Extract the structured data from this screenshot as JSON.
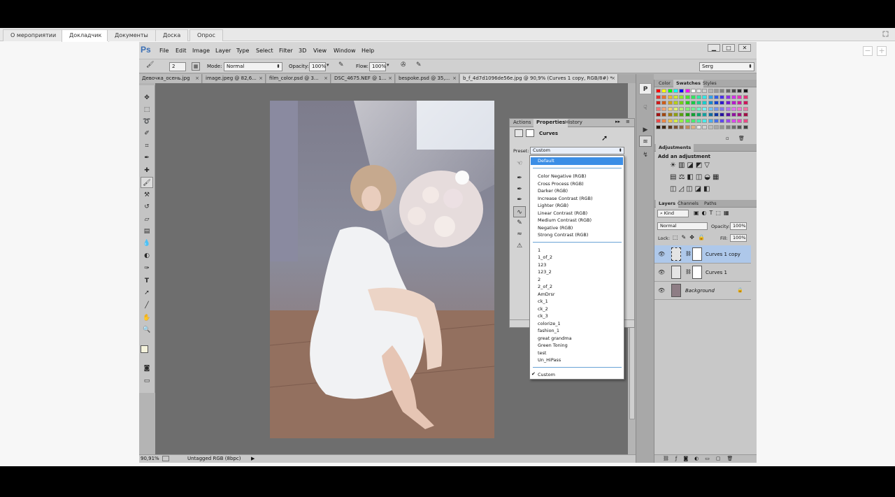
{
  "outer_tabs": [
    "О мероприятии",
    "Докладчик",
    "Документы",
    "Доска",
    "Опрос"
  ],
  "outer_active_tab": "Докладчик",
  "side_buttons": [
    "−",
    "+"
  ],
  "ps": {
    "logo": "Ps",
    "menu": [
      "File",
      "Edit",
      "Image",
      "Layer",
      "Type",
      "Select",
      "Filter",
      "3D",
      "View",
      "Window",
      "Help"
    ],
    "window_buttons": [
      "▁",
      "□",
      "✕"
    ],
    "options": {
      "brush_size": "2",
      "mode_label": "Mode:",
      "mode_value": "Normal",
      "opacity_label": "Opacity:",
      "opacity_value": "100%",
      "flow_label": "Flow:",
      "flow_value": "100%",
      "workspace": "Serg"
    },
    "doc_tabs": [
      {
        "label": "Девочка_осень.jpg",
        "active": false
      },
      {
        "label": "image.jpeg @ 82,6...",
        "active": false
      },
      {
        "label": "film_color.psd @ 3...",
        "active": false
      },
      {
        "label": "DSC_4675.NEF @ 1...",
        "active": false
      },
      {
        "label": "bespoke.psd @ 35,...",
        "active": false
      },
      {
        "label": "b_f_4d7d1096de56e.jpg @ 90,9% (Curves 1 copy, RGB/8#) *",
        "active": true
      }
    ],
    "tools": [
      "move-tool",
      "marquee-tool",
      "lasso-tool",
      "quick-select-tool",
      "crop-tool",
      "eyedropper-tool",
      "healing-tool",
      "brush-tool",
      "clone-stamp-tool",
      "history-brush-tool",
      "eraser-tool",
      "gradient-tool",
      "blur-tool",
      "dodge-tool",
      "pen-tool",
      "type-tool",
      "path-select-tool",
      "line-tool",
      "hand-tool",
      "zoom-tool"
    ],
    "status": {
      "zoom": "90,91%",
      "profile": "Untagged RGB (8bpc)"
    },
    "properties": {
      "tabs": [
        "Actions",
        "Properties",
        "History"
      ],
      "active_tab": "Properties",
      "title": "Curves",
      "preset_label": "Preset:",
      "preset_value": "Custom",
      "presets_group1": [
        "Default"
      ],
      "presets_group2": [
        "Color Negative (RGB)",
        "Cross Process (RGB)",
        "Darker (RGB)",
        "Increase Contrast (RGB)",
        "Lighter (RGB)",
        "Linear Contrast (RGB)",
        "Medium Contrast (RGB)",
        "Negative (RGB)",
        "Strong Contrast (RGB)"
      ],
      "presets_group3": [
        "1",
        "1_of_2",
        "123",
        "123_2",
        "2",
        "2_of_2",
        "AmDrsr",
        "ck_1",
        "ck_2",
        "ck_3",
        "colorize_1",
        "fashion_1",
        "great grandma",
        "Green Toning",
        "test",
        "Un_HiPass"
      ],
      "presets_group4": [
        "Custom"
      ],
      "checked_preset": "Custom"
    },
    "color_panel": {
      "tabs": [
        "Color",
        "Swatches",
        "Styles"
      ],
      "active_tab": "Swatches"
    },
    "adjustments": {
      "tab": "Adjustments",
      "heading": "Add an adjustment"
    },
    "layers": {
      "tabs": [
        "Layers",
        "Channels",
        "Paths"
      ],
      "active_tab": "Layers",
      "filter_value": "Kind",
      "blend_mode": "Normal",
      "opacity_label": "Opacity:",
      "opacity_value": "100%",
      "lock_label": "Lock:",
      "fill_label": "Fill:",
      "fill_value": "100%",
      "items": [
        {
          "name": "Curves 1 copy",
          "selected": true
        },
        {
          "name": "Curves 1",
          "selected": false
        },
        {
          "name": "Background",
          "selected": false
        }
      ]
    }
  }
}
